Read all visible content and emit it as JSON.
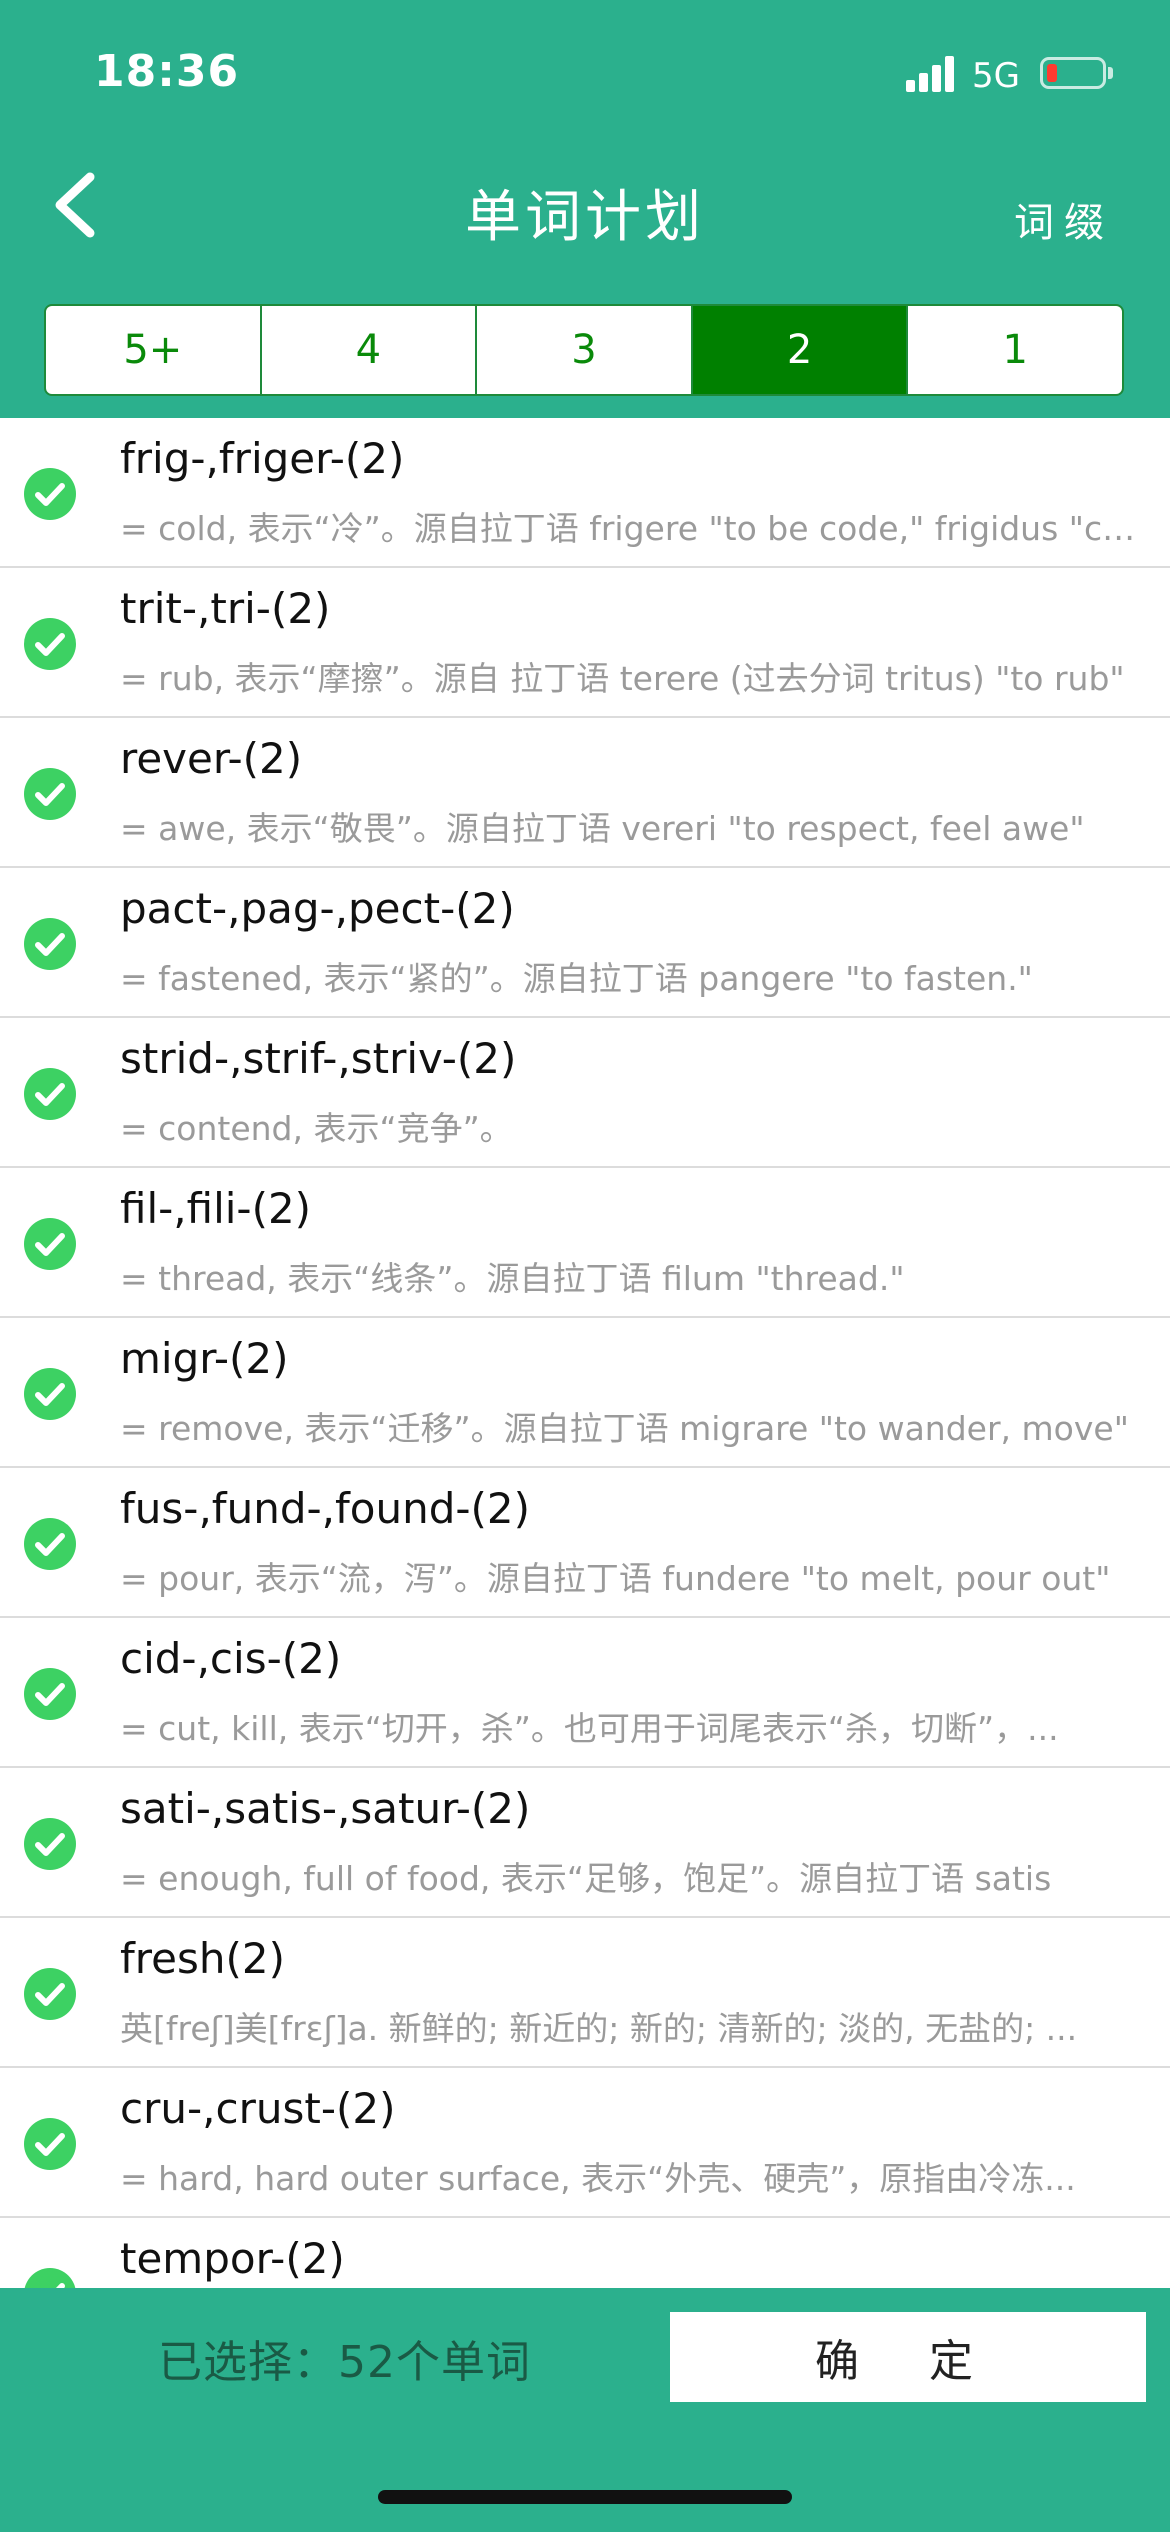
{
  "status_bar": {
    "time": "18:36",
    "network": "5G"
  },
  "header": {
    "title": "单词计划",
    "right_action": "词缀"
  },
  "tabs": [
    {
      "label": "5+",
      "active": false
    },
    {
      "label": "4",
      "active": false
    },
    {
      "label": "3",
      "active": false
    },
    {
      "label": "2",
      "active": true
    },
    {
      "label": "1",
      "active": false
    }
  ],
  "items": [
    {
      "title": "frig-,friger-(2)",
      "subtitle": "= cold, 表示“冷”。源自拉丁语 frigere \"to be code,\" frigidus \"cold\""
    },
    {
      "title": "trit-,tri-(2)",
      "subtitle": "= rub, 表示“摩擦”。源自 拉丁语 terere (过去分词 tritus) \"to rub\""
    },
    {
      "title": "rever-(2)",
      "subtitle": "= awe, 表示“敬畏”。源自拉丁语 vereri \"to respect, feel awe\""
    },
    {
      "title": "pact-,pag-,pect-(2)",
      "subtitle": "= fastened, 表示“紧的”。源自拉丁语 pangere \"to fasten.\""
    },
    {
      "title": "strid-,strif-,striv-(2)",
      "subtitle": "= contend, 表示“竞争”。"
    },
    {
      "title": "fil-,fili-(2)",
      "subtitle": "= thread, 表示“线条”。源自拉丁语 filum \"thread.\""
    },
    {
      "title": "migr-(2)",
      "subtitle": "= remove, 表示“迁移”。源自拉丁语 migrare \"to wander, move\""
    },
    {
      "title": "fus-,fund-,found-(2)",
      "subtitle": "= pour, 表示“流，泻”。源自拉丁语 fundere \"to melt, pour out\""
    },
    {
      "title": "cid-,cis-(2)",
      "subtitle": "= cut, kill, 表示“切开，杀”。也可用于词尾表示“杀，切断”，..."
    },
    {
      "title": "sati-,satis-,satur-(2)",
      "subtitle": "= enough, full of food, 表示“足够，饱足”。源自拉丁语 satis"
    },
    {
      "title": "fresh(2)",
      "subtitle": "英[freʃ]美[frɛʃ]a. 新鲜的; 新近的; 新的; 清新的; 淡的, 无盐的; ..."
    },
    {
      "title": "cru-,crust-(2)",
      "subtitle": "= hard, hard outer surface, 表示“外壳、硬壳”，原指由冷冻..."
    },
    {
      "title": "tempor-(2)",
      "subtitle": ""
    }
  ],
  "footer": {
    "selected_text": "已选择：52个单词",
    "confirm_label": "确 定"
  },
  "colors": {
    "header_bg": "#2bb08d",
    "active_tab": "#008000",
    "check": "#3dd163"
  }
}
